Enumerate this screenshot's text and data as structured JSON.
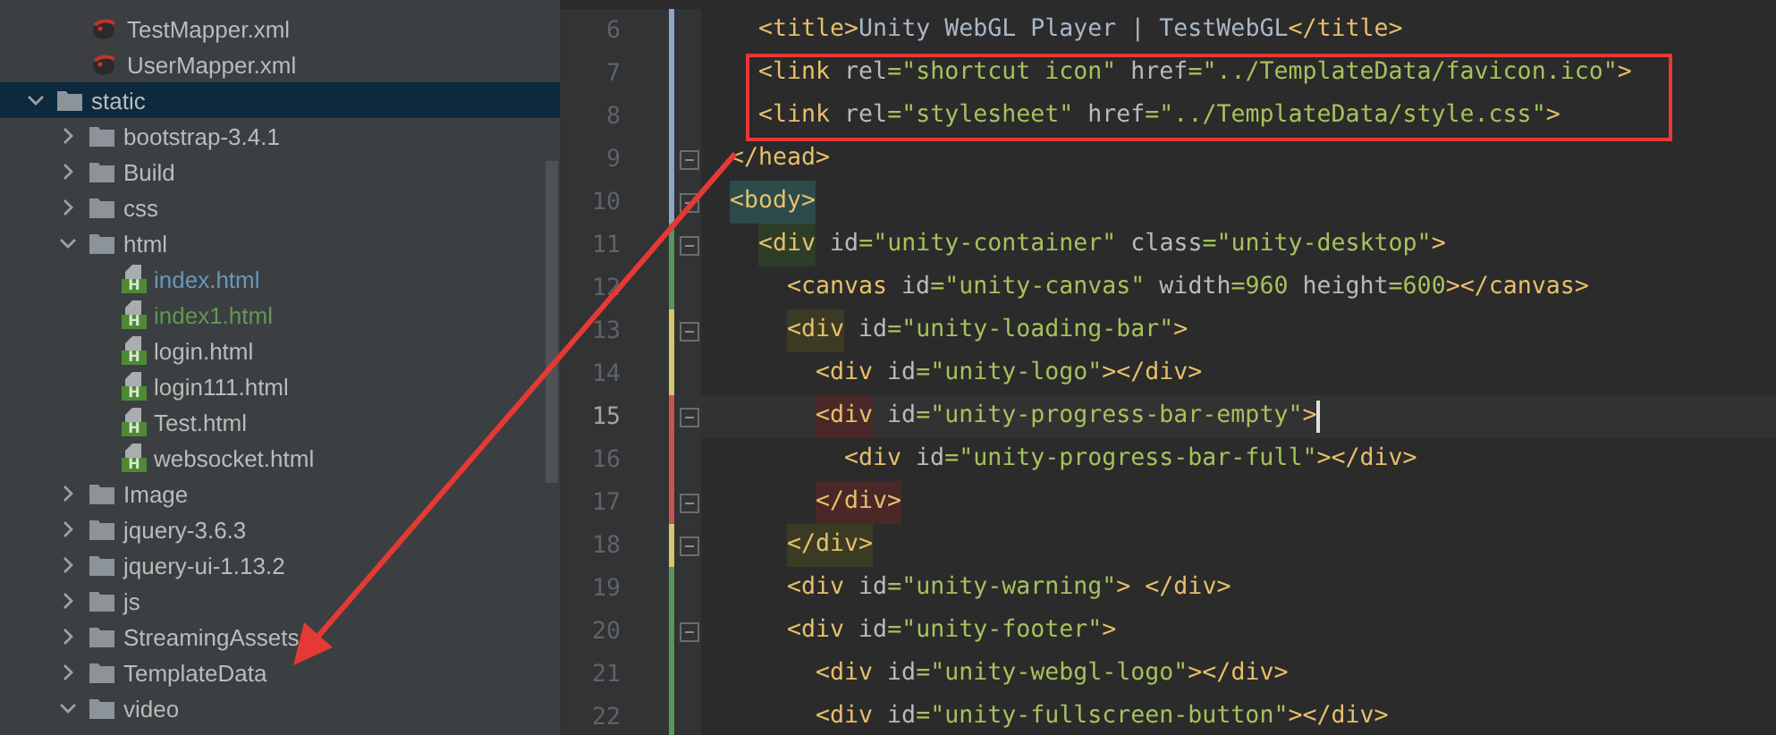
{
  "project_tree": {
    "leading_items": [
      {
        "name": "TestMapper.xml",
        "kind": "xml"
      },
      {
        "name": "UserMapper.xml",
        "kind": "xml"
      }
    ],
    "items": [
      {
        "name": "static",
        "kind": "folder",
        "expanded": true,
        "selected": true,
        "children": [
          {
            "name": "bootstrap-3.4.1",
            "kind": "folder",
            "expanded": false,
            "selected": false
          },
          {
            "name": "Build",
            "kind": "folder",
            "expanded": false,
            "selected": false
          },
          {
            "name": "css",
            "kind": "folder",
            "expanded": false,
            "selected": false
          },
          {
            "name": "html",
            "kind": "folder",
            "expanded": true,
            "selected": false,
            "children": [
              {
                "name": "index.html",
                "kind": "html",
                "badge": "H",
                "color": "#6897bb",
                "selected": false
              },
              {
                "name": "index1.html",
                "kind": "html",
                "badge": "H",
                "color": "#629755",
                "selected": false
              },
              {
                "name": "login.html",
                "kind": "html",
                "badge": "H",
                "selected": false
              },
              {
                "name": "login111.html",
                "kind": "html",
                "badge": "H",
                "selected": false
              },
              {
                "name": "Test.html",
                "kind": "html",
                "badge": "H",
                "selected": false
              },
              {
                "name": "websocket.html",
                "kind": "html",
                "badge": "H",
                "selected": false
              }
            ]
          },
          {
            "name": "Image",
            "kind": "folder",
            "expanded": false,
            "selected": false
          },
          {
            "name": "jquery-3.6.3",
            "kind": "folder",
            "expanded": false,
            "selected": false
          },
          {
            "name": "jquery-ui-1.13.2",
            "kind": "folder",
            "expanded": false,
            "selected": false
          },
          {
            "name": "js",
            "kind": "folder",
            "expanded": false,
            "selected": false
          },
          {
            "name": "StreamingAssets",
            "kind": "folder",
            "expanded": false,
            "selected": false
          },
          {
            "name": "TemplateData",
            "kind": "folder",
            "expanded": false,
            "selected": false
          },
          {
            "name": "video",
            "kind": "folder",
            "expanded": true,
            "selected": false
          }
        ]
      }
    ]
  },
  "editor": {
    "leading_lines": [
      {
        "number": "6",
        "color": "#8aa7c6",
        "fold": false,
        "current": false,
        "tokens": [
          {
            "kind": "tag",
            "text": "<title>"
          },
          {
            "kind": "text",
            "text": "Unity WebGL Player | TestWebGL"
          },
          {
            "kind": "tag",
            "text": "</title>"
          }
        ]
      },
      {
        "number": "7",
        "color": "#8aa7c6",
        "fold": false,
        "current": false,
        "tokens": [
          {
            "kind": "tag",
            "text": "<link"
          },
          {
            "kind": "attr",
            "text": " rel"
          },
          {
            "kind": "value",
            "text": "=\"shortcut icon\""
          },
          {
            "kind": "attr",
            "text": " href"
          },
          {
            "kind": "value",
            "text": "=\"../TemplateData/favicon.ico\""
          },
          {
            "kind": "tag",
            "text": ">"
          }
        ]
      },
      {
        "number": "8",
        "color": "#8aa7c6",
        "fold": false,
        "current": false,
        "tokens": [
          {
            "kind": "tag",
            "text": "<link"
          },
          {
            "kind": "attr",
            "text": " rel"
          },
          {
            "kind": "value",
            "text": "=\"stylesheet\""
          },
          {
            "kind": "attr",
            "text": " href"
          },
          {
            "kind": "value",
            "text": "=\"../TemplateData/style.css\""
          },
          {
            "kind": "tag",
            "text": ">"
          }
        ]
      }
    ],
    "lines": [
      {
        "number": "9",
        "color": "#8aa7c6",
        "fold": true,
        "current": false,
        "tokens": [
          {
            "kind": "tag",
            "text": "</head>"
          }
        ]
      },
      {
        "number": "10",
        "color": "#8aa7c6",
        "fold": true,
        "current": false,
        "tokens": [
          {
            "kind": "tag",
            "text": "<body>",
            "color": "#2c4b4a"
          }
        ],
        "children": [
          {
            "number": "11",
            "color": "#57965c",
            "fold": true,
            "current": false,
            "tokens": [
              {
                "kind": "tag",
                "text": "<div",
                "color": "#2e3d26"
              },
              {
                "kind": "attr",
                "text": " id"
              },
              {
                "kind": "value",
                "text": "=\"unity-container\""
              },
              {
                "kind": "attr",
                "text": " class"
              },
              {
                "kind": "value",
                "text": "=\"unity-desktop\""
              },
              {
                "kind": "tag",
                "text": ">"
              }
            ],
            "children": [
              {
                "number": "12",
                "color": "#57965c",
                "fold": false,
                "current": false,
                "tokens": [
                  {
                    "kind": "tag",
                    "text": "<canvas"
                  },
                  {
                    "kind": "attr",
                    "text": " id"
                  },
                  {
                    "kind": "value",
                    "text": "=\"unity-canvas\""
                  },
                  {
                    "kind": "attr",
                    "text": " width"
                  },
                  {
                    "kind": "value",
                    "text": "=960"
                  },
                  {
                    "kind": "attr",
                    "text": " height"
                  },
                  {
                    "kind": "value",
                    "text": "=600"
                  },
                  {
                    "kind": "tag",
                    "text": "></canvas>"
                  }
                ]
              },
              {
                "number": "13",
                "color": "#d6c76c",
                "fold": true,
                "current": false,
                "tokens": [
                  {
                    "kind": "tag",
                    "text": "<div",
                    "color": "#3b3b23"
                  },
                  {
                    "kind": "attr",
                    "text": " id"
                  },
                  {
                    "kind": "value",
                    "text": "=\"unity-loading-bar\""
                  },
                  {
                    "kind": "tag",
                    "text": ">"
                  }
                ],
                "children": [
                  {
                    "number": "14",
                    "color": "#d6c76c",
                    "fold": false,
                    "current": false,
                    "tokens": [
                      {
                        "kind": "tag",
                        "text": "<div"
                      },
                      {
                        "kind": "attr",
                        "text": " id"
                      },
                      {
                        "kind": "value",
                        "text": "=\"unity-logo\""
                      },
                      {
                        "kind": "tag",
                        "text": "></div>"
                      }
                    ]
                  },
                  {
                    "number": "15",
                    "color": "#c75450",
                    "fold": true,
                    "current": true,
                    "tokens": [
                      {
                        "kind": "tag",
                        "text": "<div",
                        "color": "#4a2828"
                      },
                      {
                        "kind": "attr",
                        "text": " id"
                      },
                      {
                        "kind": "value",
                        "text": "=\"unity-progress-bar-empty\""
                      },
                      {
                        "kind": "tag",
                        "text": ">"
                      }
                    ],
                    "children": [
                      {
                        "number": "16",
                        "color": "#c75450",
                        "fold": false,
                        "current": false,
                        "tokens": [
                          {
                            "kind": "tag",
                            "text": "<div"
                          },
                          {
                            "kind": "attr",
                            "text": " id"
                          },
                          {
                            "kind": "value",
                            "text": "=\"unity-progress-bar-full\""
                          },
                          {
                            "kind": "tag",
                            "text": "></div>"
                          }
                        ]
                      }
                    ]
                  },
                  {
                    "number": "17",
                    "color": "#c75450",
                    "fold": true,
                    "current": false,
                    "tokens": [
                      {
                        "kind": "tag",
                        "text": "</div>",
                        "color": "#4a2828"
                      }
                    ]
                  }
                ]
              },
              {
                "number": "18",
                "color": "#d6c76c",
                "fold": true,
                "current": false,
                "tokens": [
                  {
                    "kind": "tag",
                    "text": "</div>",
                    "color": "#3b3b23"
                  }
                ]
              },
              {
                "number": "19",
                "color": "#57965c",
                "fold": false,
                "current": false,
                "tokens": [
                  {
                    "kind": "tag",
                    "text": "<div"
                  },
                  {
                    "kind": "attr",
                    "text": " id"
                  },
                  {
                    "kind": "value",
                    "text": "=\"unity-warning\""
                  },
                  {
                    "kind": "tag",
                    "text": "> </div>"
                  }
                ]
              },
              {
                "number": "20",
                "color": "#57965c",
                "fold": true,
                "current": false,
                "tokens": [
                  {
                    "kind": "tag",
                    "text": "<div"
                  },
                  {
                    "kind": "attr",
                    "text": " id"
                  },
                  {
                    "kind": "value",
                    "text": "=\"unity-footer\""
                  },
                  {
                    "kind": "tag",
                    "text": ">"
                  }
                ],
                "children": [
                  {
                    "number": "21",
                    "color": "#57965c",
                    "fold": false,
                    "current": false,
                    "tokens": [
                      {
                        "kind": "tag",
                        "text": "<div"
                      },
                      {
                        "kind": "attr",
                        "text": " id"
                      },
                      {
                        "kind": "value",
                        "text": "=\"unity-webgl-logo\""
                      },
                      {
                        "kind": "tag",
                        "text": "></div>"
                      }
                    ]
                  },
                  {
                    "number": "22",
                    "color": "#57965c",
                    "fold": false,
                    "current": false,
                    "tokens": [
                      {
                        "kind": "tag",
                        "text": "<div"
                      },
                      {
                        "kind": "attr",
                        "text": " id"
                      },
                      {
                        "kind": "value",
                        "text": "=\"unity-fullscreen-button\""
                      },
                      {
                        "kind": "tag",
                        "text": "></div>"
                      }
                    ]
                  }
                ]
              }
            ]
          }
        ]
      }
    ]
  }
}
